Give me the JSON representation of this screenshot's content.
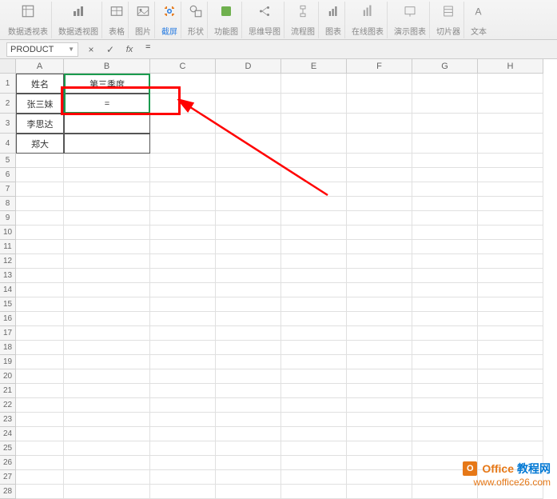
{
  "ribbon": {
    "groups": [
      {
        "label": "数据透视表"
      },
      {
        "label": "数据透视图"
      },
      {
        "label": "表格"
      },
      {
        "label": "图片"
      },
      {
        "label": "截屏",
        "active": true
      },
      {
        "label": "形状"
      },
      {
        "label": "功能图"
      },
      {
        "label": "思维导图"
      },
      {
        "label": "流程图"
      },
      {
        "label": "图表"
      },
      {
        "label": "在线图表"
      },
      {
        "label": "演示图表"
      },
      {
        "label": "切片器"
      },
      {
        "label": "文本"
      }
    ]
  },
  "formula_bar": {
    "name_box": "PRODUCT",
    "cancel": "×",
    "confirm": "✓",
    "fx": "fx",
    "formula": "="
  },
  "columns": [
    "A",
    "B",
    "C",
    "D",
    "E",
    "F",
    "G",
    "H"
  ],
  "data_cells": {
    "A1": "姓名",
    "B1": "第三季度",
    "A2": "张三妹",
    "B2": "=",
    "A3": "李思达",
    "A4": "郑大"
  },
  "watermark": {
    "brand": "Office",
    "rest": "教程网",
    "url": "www.office26.com",
    "icon": "O"
  }
}
